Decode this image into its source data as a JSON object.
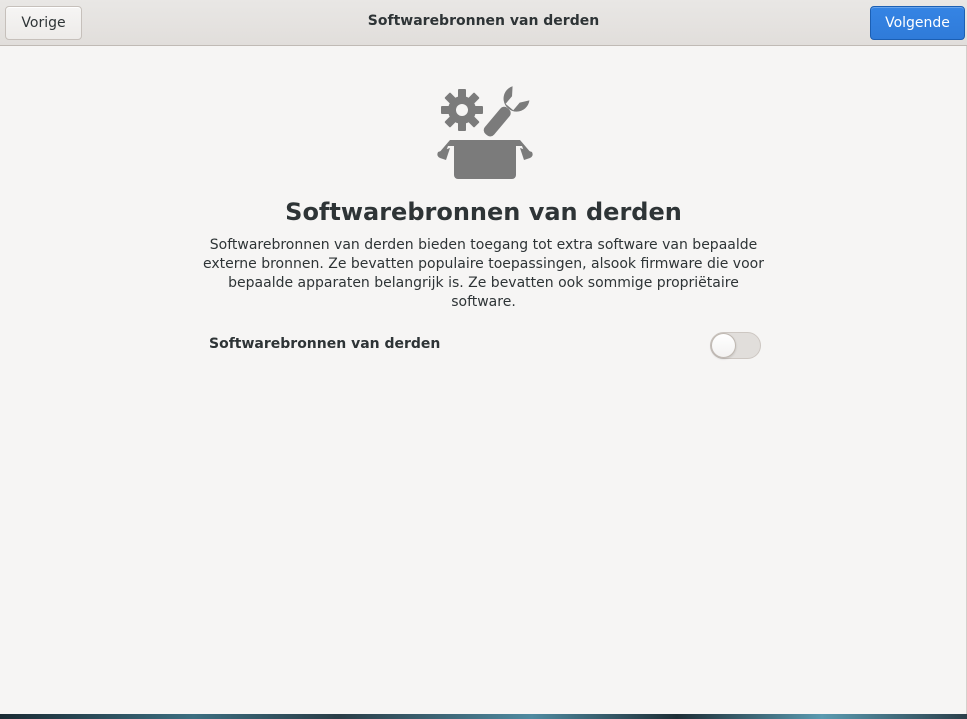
{
  "header": {
    "back_label": "Vorige",
    "title": "Softwarebronnen van derden",
    "next_label": "Volgende"
  },
  "main": {
    "icon": "gear-wrench-box-icon",
    "title": "Softwarebronnen van derden",
    "description": "Softwarebronnen van derden bieden toegang tot extra software van bepaalde externe bronnen. Ze bevatten populaire toepassingen, alsook firmware die voor bepaalde apparaten belangrijk is. Ze bevatten ook sommige propriëtaire software.",
    "toggle_label": "Softwarebronnen van derden",
    "toggle_state": "off"
  },
  "colors": {
    "accent": "#3584e4",
    "background": "#f6f5f4",
    "icon": "#7b7b7b"
  }
}
